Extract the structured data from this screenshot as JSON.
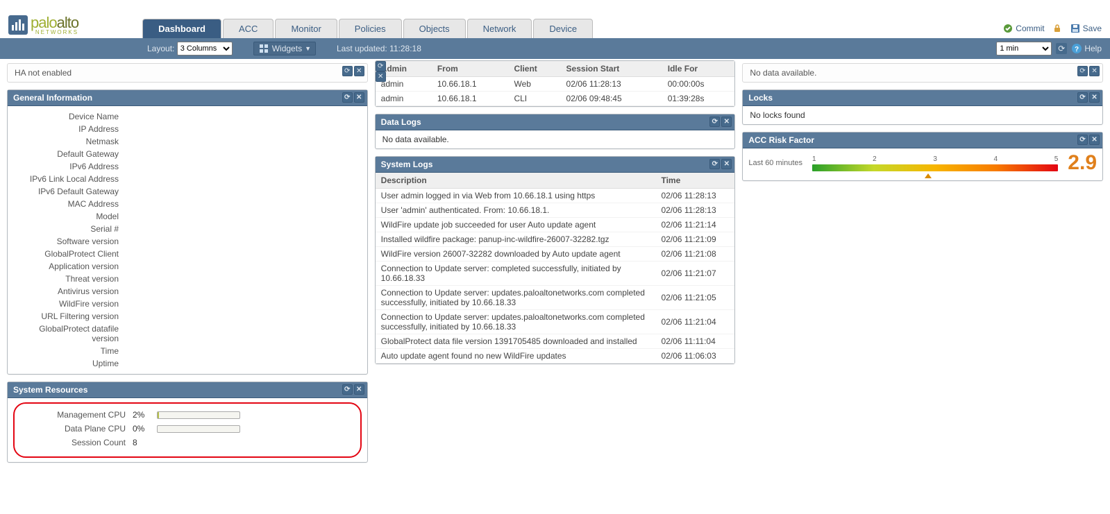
{
  "brand": {
    "name1": "palo",
    "name2": "alto",
    "sub": "NETWORKS"
  },
  "tabs": [
    "Dashboard",
    "ACC",
    "Monitor",
    "Policies",
    "Objects",
    "Network",
    "Device"
  ],
  "active_tab": "Dashboard",
  "top_actions": {
    "commit": "Commit",
    "save": "Save"
  },
  "subbar": {
    "layout_label": "Layout:",
    "layout_value": "3 Columns",
    "widgets_label": "Widgets",
    "last_updated_label": "Last updated:",
    "last_updated_value": "11:28:18",
    "interval_value": "1 min",
    "help_label": "Help"
  },
  "ha_widget": {
    "text": "HA not enabled"
  },
  "general_info": {
    "title": "General Information",
    "fields": [
      "Device Name",
      "IP Address",
      "Netmask",
      "Default Gateway",
      "IPv6 Address",
      "IPv6 Link Local Address",
      "IPv6 Default Gateway",
      "MAC Address",
      "Model",
      "Serial #",
      "Software version",
      "GlobalProtect Client",
      "Application version",
      "Threat version",
      "Antivirus version",
      "WildFire version",
      "URL Filtering version",
      "GlobalProtect datafile version",
      "Time",
      "Uptime"
    ]
  },
  "system_resources": {
    "title": "System Resources",
    "rows": [
      {
        "label": "Management CPU",
        "value": "2%",
        "pct": 2
      },
      {
        "label": "Data Plane CPU",
        "value": "0%",
        "pct": 0
      },
      {
        "label": "Session Count",
        "value": "8",
        "pct": null
      }
    ]
  },
  "admins_table": {
    "headers": [
      "Admin",
      "From",
      "Client",
      "Session Start",
      "Idle For"
    ],
    "rows": [
      [
        "admin",
        "10.66.18.1",
        "Web",
        "02/06 11:28:13",
        "00:00:00s"
      ],
      [
        "admin",
        "10.66.18.1",
        "CLI",
        "02/06 09:48:45",
        "01:39:28s"
      ]
    ]
  },
  "data_logs": {
    "title": "Data Logs",
    "msg": "No data available."
  },
  "system_logs": {
    "title": "System Logs",
    "headers": [
      "Description",
      "Time"
    ],
    "rows": [
      [
        "User admin logged in via Web from 10.66.18.1 using https",
        "02/06 11:28:13"
      ],
      [
        "User 'admin' authenticated. From: 10.66.18.1.",
        "02/06 11:28:13"
      ],
      [
        "WildFire update job succeeded for user Auto update agent",
        "02/06 11:21:14"
      ],
      [
        "Installed wildfire package: panup-inc-wildfire-26007-32282.tgz",
        "02/06 11:21:09"
      ],
      [
        "WildFire version 26007-32282 downloaded by Auto update agent",
        "02/06 11:21:08"
      ],
      [
        "Connection to Update server: completed successfully, initiated by 10.66.18.33",
        "02/06 11:21:07"
      ],
      [
        "Connection to Update server: updates.paloaltonetworks.com completed successfully, initiated by 10.66.18.33",
        "02/06 11:21:05"
      ],
      [
        "Connection to Update server: updates.paloaltonetworks.com completed successfully, initiated by 10.66.18.33",
        "02/06 11:21:04"
      ],
      [
        "GlobalProtect data file version 1391705485 downloaded and installed",
        "02/06 11:11:04"
      ],
      [
        "Auto update agent found no new WildFire updates",
        "02/06 11:06:03"
      ]
    ]
  },
  "col3_plain": {
    "msg": "No data available."
  },
  "locks": {
    "title": "Locks",
    "msg": "No locks found"
  },
  "risk": {
    "title": "ACC Risk Factor",
    "period": "Last 60 minutes",
    "ticks": [
      "1",
      "2",
      "3",
      "4",
      "5"
    ],
    "value": "2.9",
    "marker_pct": 47
  }
}
